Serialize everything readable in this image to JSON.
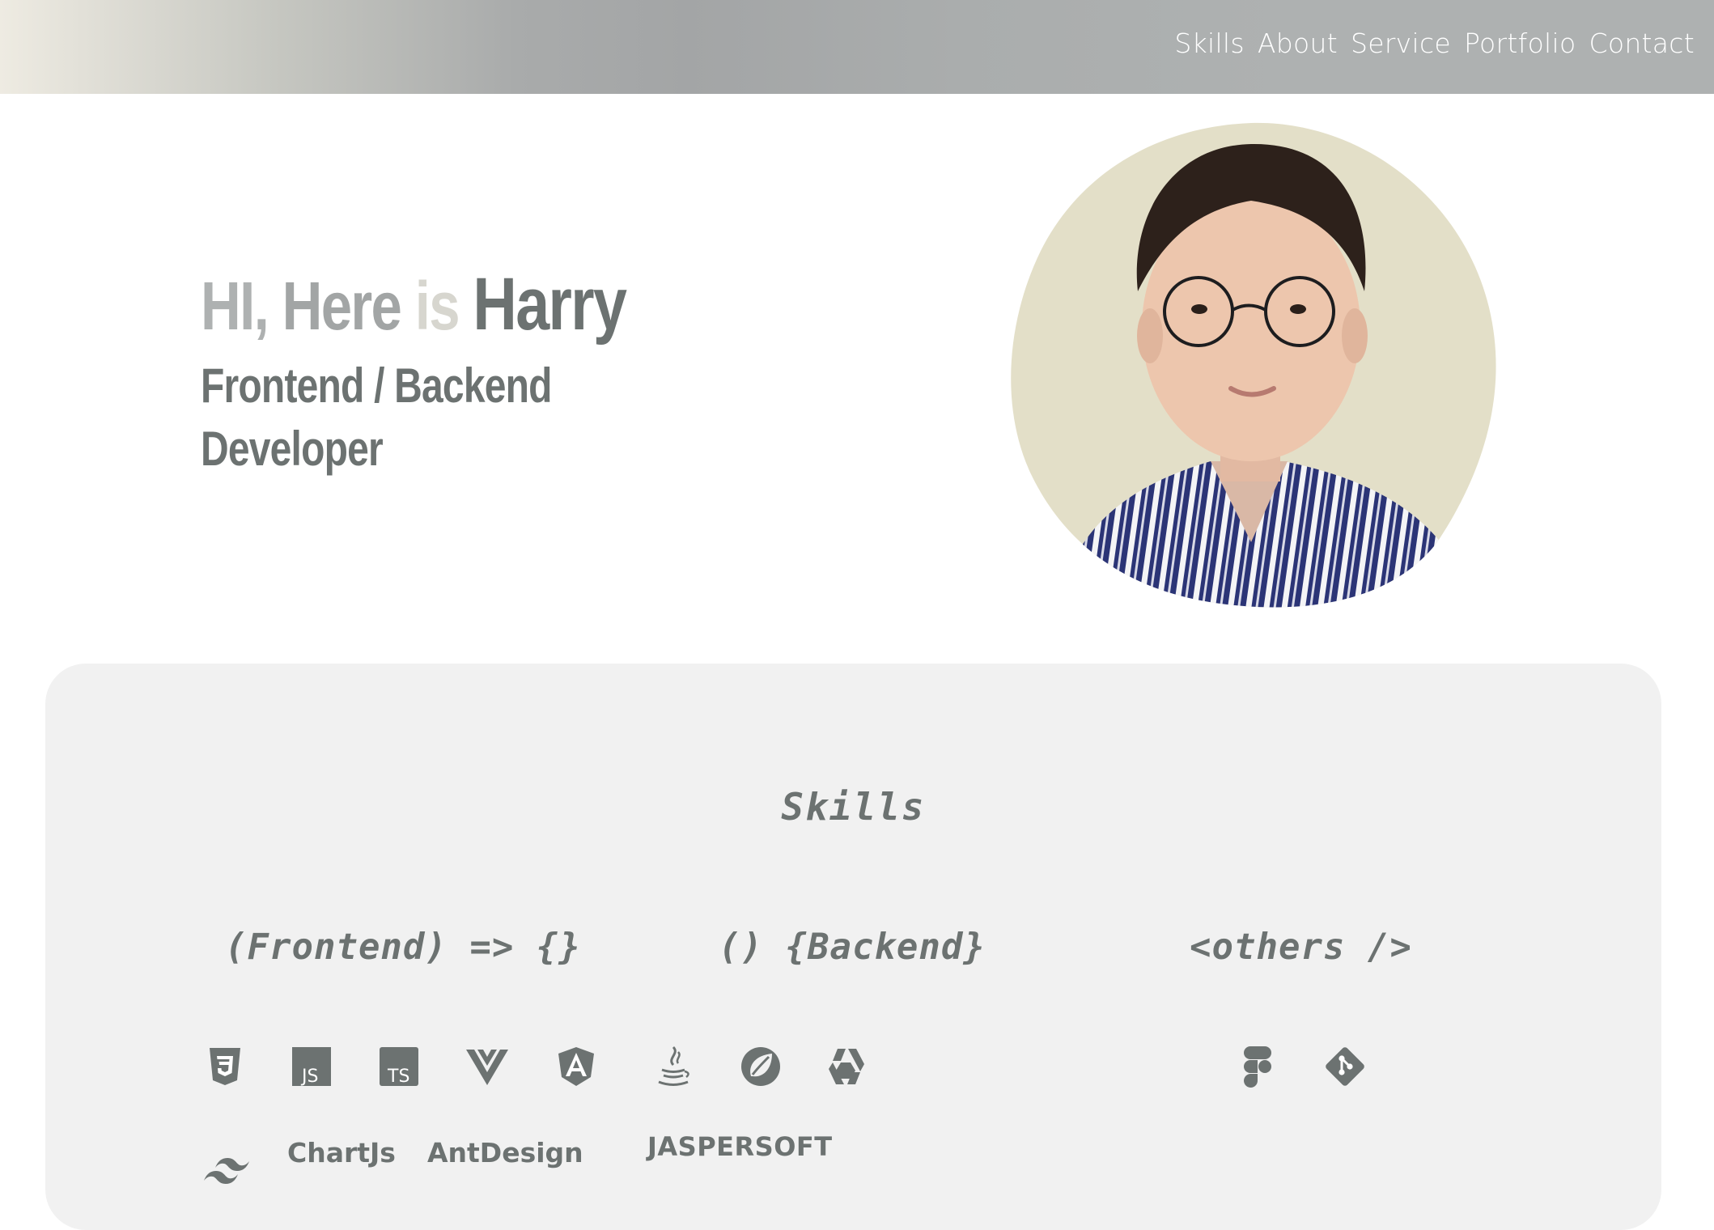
{
  "nav": {
    "items": [
      {
        "label": "Skills"
      },
      {
        "label": "About"
      },
      {
        "label": "Service"
      },
      {
        "label": "Portfolio"
      },
      {
        "label": "Contact"
      }
    ]
  },
  "hero": {
    "greeting_part1": "HI,",
    "greeting_part2": "Here",
    "greeting_part3": "is",
    "name": "Harry",
    "role_line1": "Frontend / Backend",
    "role_line2": "Developer"
  },
  "skills": {
    "title": "Skills",
    "columns": [
      {
        "title": "(Frontend) => {}"
      },
      {
        "title": "() {Backend}"
      },
      {
        "title": "<others />"
      }
    ],
    "frontend_icons": [
      "css3-icon",
      "javascript-icon",
      "typescript-icon",
      "vue-icon",
      "angular-icon",
      "tailwind-icon"
    ],
    "frontend_text": [
      "ChartJs",
      "AntDesign"
    ],
    "backend_icons": [
      "java-icon",
      "spring-icon",
      "hibernate-icon"
    ],
    "backend_text": [
      "JASPERSOFT"
    ],
    "others_icons": [
      "figma-icon",
      "git-icon"
    ]
  },
  "colors": {
    "text_dark": "#6c7271",
    "panel_bg": "#f1f1f1",
    "photo_bg": "#e3dfc8",
    "shirt_navy": "#2b3476"
  }
}
